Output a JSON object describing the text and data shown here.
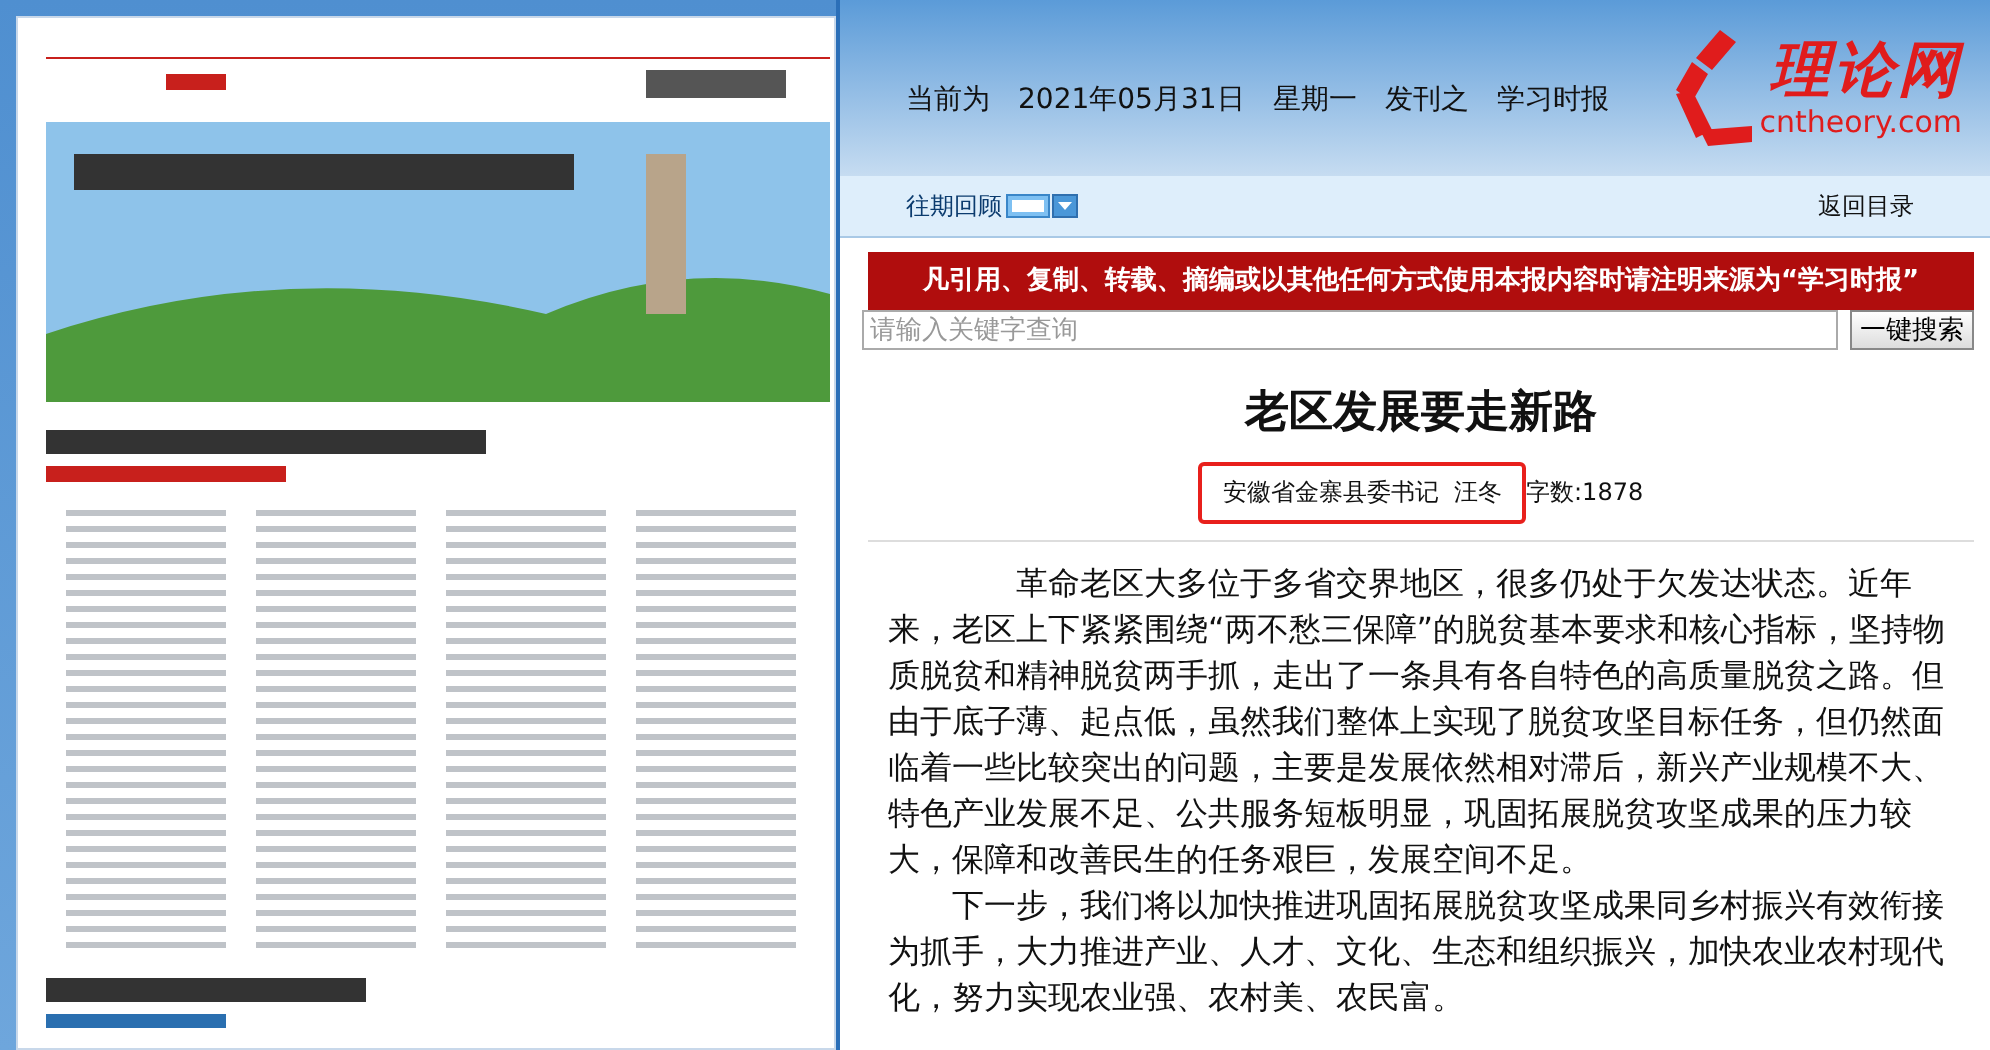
{
  "header": {
    "date_line": [
      "当前为",
      "2021年05月31日",
      "星期一",
      "发刊之",
      "学习时报"
    ]
  },
  "logo": {
    "name": "理论网",
    "domain": "cntheory.com"
  },
  "nav": {
    "archive_label": "往期回顾",
    "return_link": "返回目录"
  },
  "notice": "凡引用、复制、转载、摘编或以其他任何方式使用本报内容时请注明来源为“学习时报”",
  "search": {
    "placeholder": "请输入关键字查询",
    "button": "一键搜索"
  },
  "article": {
    "title": "老区发展要走新路",
    "byline": "安徽省金寨县委书记  汪冬",
    "byline_highlighted": true,
    "word_count": "字数:1878",
    "paragraphs": [
      "革命老区大多位于多省交界地区，很多仍处于欠发达状态。近年来，老区上下紧紧围绕“两不愁三保障”的脱贫基本要求和核心指标，坚持物质脱贫和精神脱贫两手抓，走出了一条具有各自特色的高质量脱贫之路。但由于底子薄、起点低，虽然我们整体上实现了脱贫攻坚目标任务，但仍然面临着一些比较突出的问题，主要是发展依然相对滞后，新兴产业规模不大、特色产业发展不足、公共服务短板明显，巩固拓展脱贫攻坚成果的压力较大，保障和改善民生的任务艰巨，发展空间不足。",
      "下一步，我们将以加快推进巩固拓展脱贫攻坚成果同乡村振兴有效衔接为抓手，大力推进产业、人才、文化、生态和组织振兴，加快农业农村现代化，努力实现农业强、农村美、农民富。"
    ]
  }
}
